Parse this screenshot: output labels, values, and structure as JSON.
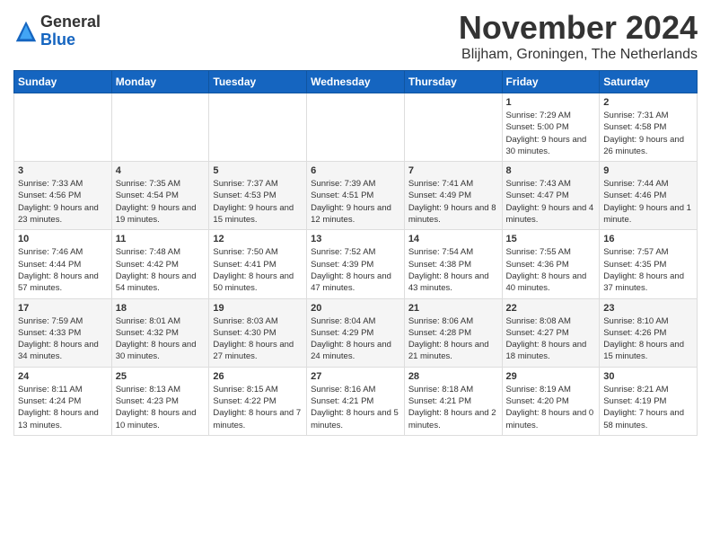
{
  "header": {
    "logo_line1": "General",
    "logo_line2": "Blue",
    "month": "November 2024",
    "location": "Blijham, Groningen, The Netherlands"
  },
  "days_of_week": [
    "Sunday",
    "Monday",
    "Tuesday",
    "Wednesday",
    "Thursday",
    "Friday",
    "Saturday"
  ],
  "weeks": [
    [
      {
        "day": "",
        "info": ""
      },
      {
        "day": "",
        "info": ""
      },
      {
        "day": "",
        "info": ""
      },
      {
        "day": "",
        "info": ""
      },
      {
        "day": "",
        "info": ""
      },
      {
        "day": "1",
        "info": "Sunrise: 7:29 AM\nSunset: 5:00 PM\nDaylight: 9 hours and 30 minutes."
      },
      {
        "day": "2",
        "info": "Sunrise: 7:31 AM\nSunset: 4:58 PM\nDaylight: 9 hours and 26 minutes."
      }
    ],
    [
      {
        "day": "3",
        "info": "Sunrise: 7:33 AM\nSunset: 4:56 PM\nDaylight: 9 hours and 23 minutes."
      },
      {
        "day": "4",
        "info": "Sunrise: 7:35 AM\nSunset: 4:54 PM\nDaylight: 9 hours and 19 minutes."
      },
      {
        "day": "5",
        "info": "Sunrise: 7:37 AM\nSunset: 4:53 PM\nDaylight: 9 hours and 15 minutes."
      },
      {
        "day": "6",
        "info": "Sunrise: 7:39 AM\nSunset: 4:51 PM\nDaylight: 9 hours and 12 minutes."
      },
      {
        "day": "7",
        "info": "Sunrise: 7:41 AM\nSunset: 4:49 PM\nDaylight: 9 hours and 8 minutes."
      },
      {
        "day": "8",
        "info": "Sunrise: 7:43 AM\nSunset: 4:47 PM\nDaylight: 9 hours and 4 minutes."
      },
      {
        "day": "9",
        "info": "Sunrise: 7:44 AM\nSunset: 4:46 PM\nDaylight: 9 hours and 1 minute."
      }
    ],
    [
      {
        "day": "10",
        "info": "Sunrise: 7:46 AM\nSunset: 4:44 PM\nDaylight: 8 hours and 57 minutes."
      },
      {
        "day": "11",
        "info": "Sunrise: 7:48 AM\nSunset: 4:42 PM\nDaylight: 8 hours and 54 minutes."
      },
      {
        "day": "12",
        "info": "Sunrise: 7:50 AM\nSunset: 4:41 PM\nDaylight: 8 hours and 50 minutes."
      },
      {
        "day": "13",
        "info": "Sunrise: 7:52 AM\nSunset: 4:39 PM\nDaylight: 8 hours and 47 minutes."
      },
      {
        "day": "14",
        "info": "Sunrise: 7:54 AM\nSunset: 4:38 PM\nDaylight: 8 hours and 43 minutes."
      },
      {
        "day": "15",
        "info": "Sunrise: 7:55 AM\nSunset: 4:36 PM\nDaylight: 8 hours and 40 minutes."
      },
      {
        "day": "16",
        "info": "Sunrise: 7:57 AM\nSunset: 4:35 PM\nDaylight: 8 hours and 37 minutes."
      }
    ],
    [
      {
        "day": "17",
        "info": "Sunrise: 7:59 AM\nSunset: 4:33 PM\nDaylight: 8 hours and 34 minutes."
      },
      {
        "day": "18",
        "info": "Sunrise: 8:01 AM\nSunset: 4:32 PM\nDaylight: 8 hours and 30 minutes."
      },
      {
        "day": "19",
        "info": "Sunrise: 8:03 AM\nSunset: 4:30 PM\nDaylight: 8 hours and 27 minutes."
      },
      {
        "day": "20",
        "info": "Sunrise: 8:04 AM\nSunset: 4:29 PM\nDaylight: 8 hours and 24 minutes."
      },
      {
        "day": "21",
        "info": "Sunrise: 8:06 AM\nSunset: 4:28 PM\nDaylight: 8 hours and 21 minutes."
      },
      {
        "day": "22",
        "info": "Sunrise: 8:08 AM\nSunset: 4:27 PM\nDaylight: 8 hours and 18 minutes."
      },
      {
        "day": "23",
        "info": "Sunrise: 8:10 AM\nSunset: 4:26 PM\nDaylight: 8 hours and 15 minutes."
      }
    ],
    [
      {
        "day": "24",
        "info": "Sunrise: 8:11 AM\nSunset: 4:24 PM\nDaylight: 8 hours and 13 minutes."
      },
      {
        "day": "25",
        "info": "Sunrise: 8:13 AM\nSunset: 4:23 PM\nDaylight: 8 hours and 10 minutes."
      },
      {
        "day": "26",
        "info": "Sunrise: 8:15 AM\nSunset: 4:22 PM\nDaylight: 8 hours and 7 minutes."
      },
      {
        "day": "27",
        "info": "Sunrise: 8:16 AM\nSunset: 4:21 PM\nDaylight: 8 hours and 5 minutes."
      },
      {
        "day": "28",
        "info": "Sunrise: 8:18 AM\nSunset: 4:21 PM\nDaylight: 8 hours and 2 minutes."
      },
      {
        "day": "29",
        "info": "Sunrise: 8:19 AM\nSunset: 4:20 PM\nDaylight: 8 hours and 0 minutes."
      },
      {
        "day": "30",
        "info": "Sunrise: 8:21 AM\nSunset: 4:19 PM\nDaylight: 7 hours and 58 minutes."
      }
    ]
  ]
}
